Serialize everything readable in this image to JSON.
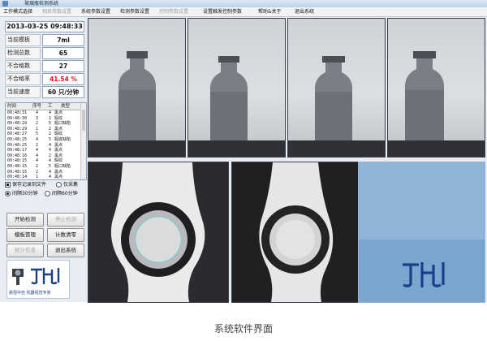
{
  "window": {
    "title": "玻璃瓶检测系统"
  },
  "menu": [
    {
      "label": "工作模式选择",
      "enabled": true
    },
    {
      "label": "相机参数设置",
      "enabled": false
    },
    {
      "label": "系统参数设置",
      "enabled": true
    },
    {
      "label": "检测参数设置",
      "enabled": true
    },
    {
      "label": "控制参数设置",
      "enabled": false
    },
    {
      "label": "设置触发控制参数",
      "enabled": true
    },
    {
      "label": "帮助&关于",
      "enabled": true
    },
    {
      "label": "退出系统",
      "enabled": true
    }
  ],
  "datetime": "2013-03-25 09:48:33",
  "stats": [
    {
      "label": "当前模板",
      "value": "7ml"
    },
    {
      "label": "检测总数",
      "value": "65"
    },
    {
      "label": "不合格数",
      "value": "27"
    },
    {
      "label": "不合格率",
      "value": "41.54 %",
      "alert": true
    },
    {
      "label": "当前速度",
      "value": "60 只/分钟"
    }
  ],
  "log_table": {
    "headers": [
      "时间",
      "序号",
      "工",
      "类型"
    ],
    "rows": [
      [
        "09:48:31",
        "4",
        "4",
        "黑点"
      ],
      [
        "09:48:30",
        "3",
        "1",
        "瑕纹"
      ],
      [
        "09:48:29",
        "2",
        "5",
        "瓶口缺陷"
      ],
      [
        "09:48:29",
        "1",
        "2",
        "黑点"
      ],
      [
        "09:48:27",
        "5",
        "2",
        "瑕纹"
      ],
      [
        "09:48:25",
        "4",
        "5",
        "瓶底缺陷"
      ],
      [
        "09:48:25",
        "2",
        "4",
        "黑点"
      ],
      [
        "09:48:17",
        "4",
        "4",
        "黑点"
      ],
      [
        "09:48:16",
        "4",
        "2",
        "黑点"
      ],
      [
        "09:48:15",
        "4",
        "4",
        "瑕纹"
      ],
      [
        "09:48:15",
        "2",
        "5",
        "瓶口缺陷"
      ],
      [
        "09:48:15",
        "2",
        "4",
        "黑点"
      ],
      [
        "09:48:14",
        "1",
        "4",
        "黑点"
      ]
    ]
  },
  "options": {
    "save_log": {
      "label": "保存记录到文件",
      "checked": true
    },
    "collect": {
      "label": "仅采集",
      "checked": false
    },
    "interval_30": {
      "label": "间隔30分钟",
      "selected": true
    },
    "interval_60": {
      "label": "间隔60分钟",
      "selected": false
    }
  },
  "buttons": {
    "start": {
      "label": "开始检测",
      "enabled": true
    },
    "stop": {
      "label": "停止检测",
      "enabled": false
    },
    "template": {
      "label": "模板管理",
      "enabled": true
    },
    "clear_count": {
      "label": "计数清零",
      "enabled": true
    },
    "stats": {
      "label": "统计信息",
      "enabled": false
    },
    "exit": {
      "label": "退出系统",
      "enabled": true
    }
  },
  "logo": {
    "tagline": "晨恒中自 机器视觉专家"
  },
  "caption": "系统软件界面",
  "colors": {
    "alert": "#e0161c",
    "panel": "#e8edf3",
    "logo_blue": "#1b3f8a"
  }
}
